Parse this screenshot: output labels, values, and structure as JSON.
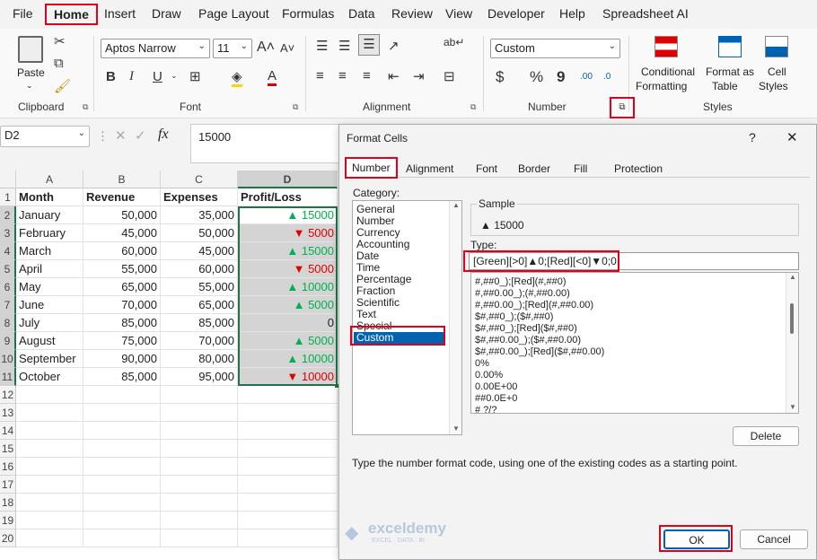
{
  "menu": [
    "File",
    "Home",
    "Insert",
    "Draw",
    "Page Layout",
    "Formulas",
    "Data",
    "Review",
    "View",
    "Developer",
    "Help",
    "Spreadsheet AI"
  ],
  "ribbon": {
    "paste_label": "Paste",
    "font_name": "Aptos Narrow",
    "font_size": "11",
    "number_format": "Custom",
    "cond_format": [
      "Conditional",
      "Formatting"
    ],
    "format_table": [
      "Format as",
      "Table"
    ],
    "cell_styles": [
      "Cell",
      "Styles"
    ],
    "groups": [
      "Clipboard",
      "Font",
      "Alignment",
      "Number",
      "Styles"
    ],
    "percent": "%",
    "comma": "9",
    "currency": "$",
    "inc_dec": ".00",
    "dec_dec": ".0"
  },
  "formula_bar": {
    "name_box": "D2",
    "fx": "fx",
    "value": "15000"
  },
  "sheet": {
    "columns": [
      "A",
      "B",
      "C",
      "D"
    ],
    "headers": [
      "Month",
      "Revenue",
      "Expenses",
      "Profit/Loss"
    ],
    "rows": [
      {
        "month": "January",
        "revenue": "50,000",
        "expenses": "35,000",
        "arrow": "▲",
        "profit": "15000",
        "dir": "up"
      },
      {
        "month": "February",
        "revenue": "45,000",
        "expenses": "50,000",
        "arrow": "▼",
        "profit": "5000",
        "dir": "down"
      },
      {
        "month": "March",
        "revenue": "60,000",
        "expenses": "45,000",
        "arrow": "▲",
        "profit": "15000",
        "dir": "up"
      },
      {
        "month": "April",
        "revenue": "55,000",
        "expenses": "60,000",
        "arrow": "▼",
        "profit": "5000",
        "dir": "down"
      },
      {
        "month": "May",
        "revenue": "65,000",
        "expenses": "55,000",
        "arrow": "▲",
        "profit": "10000",
        "dir": "up"
      },
      {
        "month": "June",
        "revenue": "70,000",
        "expenses": "65,000",
        "arrow": "▲",
        "profit": "5000",
        "dir": "up"
      },
      {
        "month": "July",
        "revenue": "85,000",
        "expenses": "85,000",
        "arrow": "",
        "profit": "0",
        "dir": "zero"
      },
      {
        "month": "August",
        "revenue": "75,000",
        "expenses": "70,000",
        "arrow": "▲",
        "profit": "5000",
        "dir": "up"
      },
      {
        "month": "September",
        "revenue": "90,000",
        "expenses": "80,000",
        "arrow": "▲",
        "profit": "10000",
        "dir": "up"
      },
      {
        "month": "October",
        "revenue": "85,000",
        "expenses": "95,000",
        "arrow": "▼",
        "profit": "10000",
        "dir": "down"
      }
    ],
    "row_numbers": [
      "1",
      "2",
      "3",
      "4",
      "5",
      "6",
      "7",
      "8",
      "9",
      "10",
      "11",
      "12",
      "13",
      "14",
      "15",
      "16",
      "17",
      "18",
      "19",
      "20"
    ]
  },
  "dialog": {
    "title": "Format Cells",
    "help": "?",
    "close": "✕",
    "tabs": [
      "Number",
      "Alignment",
      "Font",
      "Border",
      "Fill",
      "Protection"
    ],
    "category_label": "Category:",
    "categories": [
      "General",
      "Number",
      "Currency",
      "Accounting",
      "Date",
      "Time",
      "Percentage",
      "Fraction",
      "Scientific",
      "Text",
      "Special",
      "Custom"
    ],
    "sample_label": "Sample",
    "sample_value": "▲ 15000",
    "type_label": "Type:",
    "type_value": "[Green][>0]▲0;[Red][<0]▼0;0",
    "formats": [
      "#,##0_);[Red](#,##0)",
      "#,##0.00_);(#,##0.00)",
      "#,##0.00_);[Red](#,##0.00)",
      "$#,##0_);($#,##0)",
      "$#,##0_);[Red]($#,##0)",
      "$#,##0.00_);($#,##0.00)",
      "$#,##0.00_);[Red]($#,##0.00)",
      "0%",
      "0.00%",
      "0.00E+00",
      "##0.0E+0",
      "# ?/?"
    ],
    "delete_label": "Delete",
    "hint": "Type the number format code, using one of the existing codes as a starting point.",
    "ok_label": "OK",
    "cancel_label": "Cancel",
    "watermark": "exceldemy",
    "watermark_sub": "EXCEL · DATA · BI"
  },
  "colors": {
    "up": "#00b050",
    "down": "#e00000",
    "highlight": "#e0001b",
    "selected": "#0063b1"
  }
}
